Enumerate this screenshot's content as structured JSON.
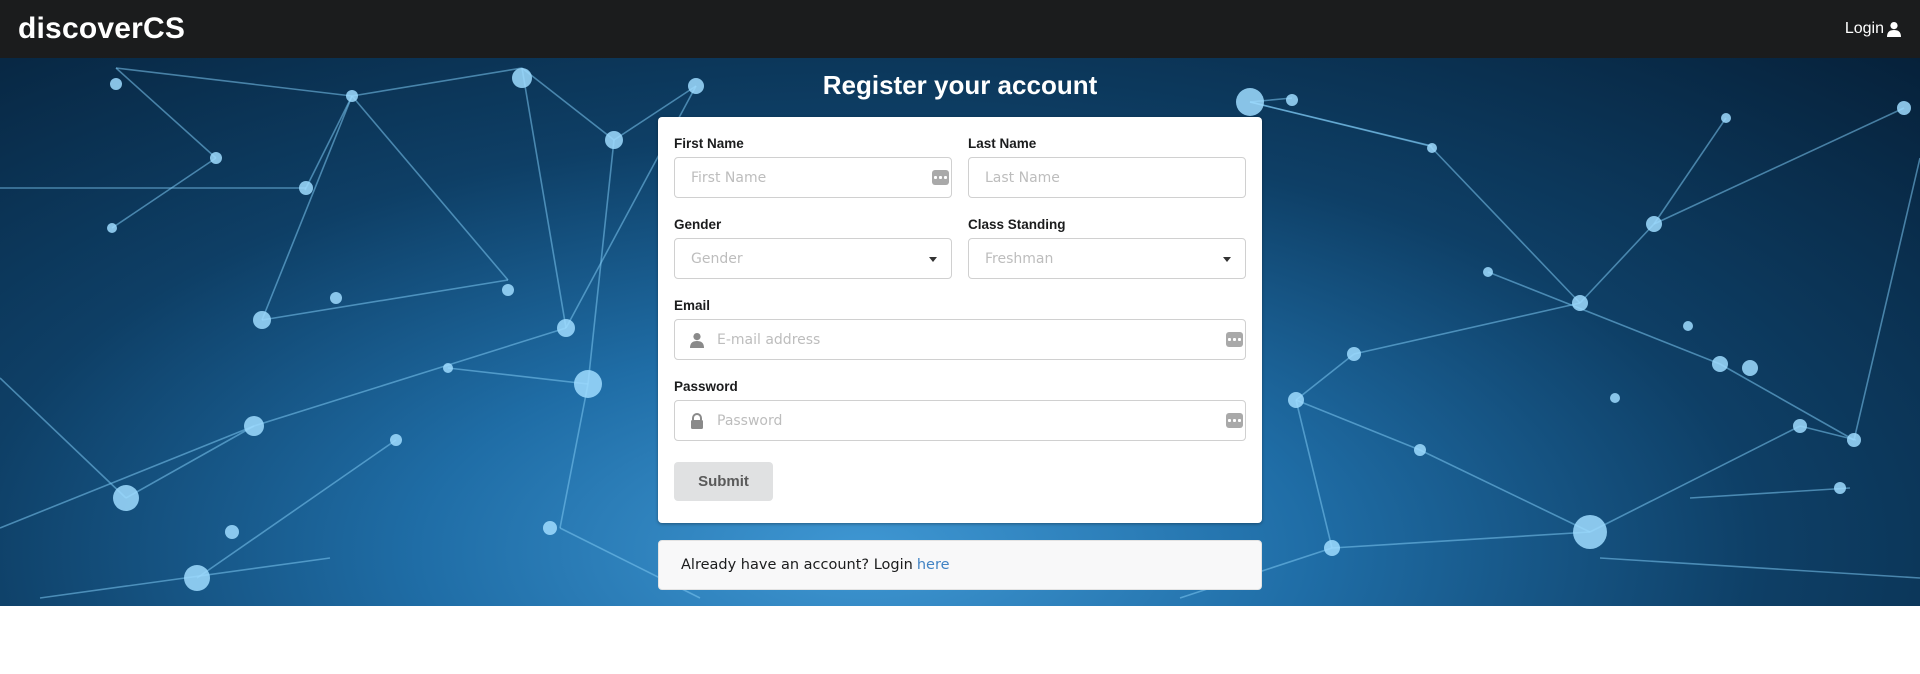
{
  "navbar": {
    "brand": "discoverCS",
    "login_label": "Login",
    "login_icon": "user-icon"
  },
  "page": {
    "title": "Register your account"
  },
  "form": {
    "first_name": {
      "label": "First Name",
      "placeholder": "First Name"
    },
    "last_name": {
      "label": "Last Name",
      "placeholder": "Last Name"
    },
    "gender": {
      "label": "Gender",
      "selected": "Gender"
    },
    "class_standing": {
      "label": "Class Standing",
      "selected": "Freshman"
    },
    "email": {
      "label": "Email",
      "placeholder": "E-mail address",
      "icon": "user-icon"
    },
    "password": {
      "label": "Password",
      "placeholder": "Password",
      "icon": "lock-icon"
    },
    "submit_label": "Submit"
  },
  "footer_message": {
    "text": "Already have an account? Login",
    "link_text": "here"
  },
  "colors": {
    "navbar_bg": "#1b1c1d",
    "link": "#4183c4",
    "button_bg": "#e0e1e2"
  }
}
